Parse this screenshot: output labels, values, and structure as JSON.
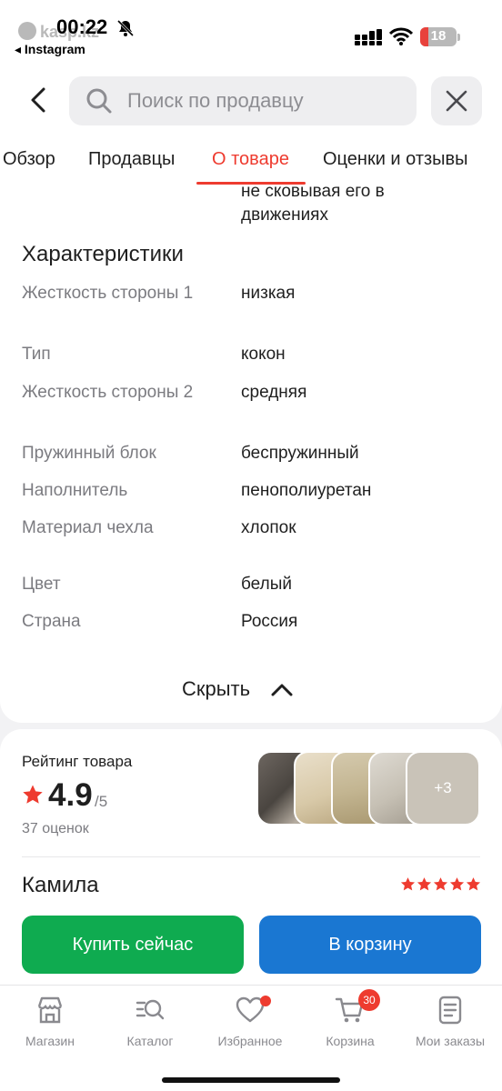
{
  "status_bar": {
    "brand_ghost": "kasp.kz",
    "time": "00:22",
    "back_app": "◂ Instagram",
    "battery": "18",
    "icons": [
      "bell-slash-icon",
      "signal-icon",
      "wifi-icon",
      "battery-icon"
    ]
  },
  "header": {
    "search_placeholder": "Поиск по продавцу",
    "icons": [
      "back-chevron-icon",
      "search-icon",
      "close-icon"
    ]
  },
  "tabs": [
    {
      "label": "Обзор",
      "active": false
    },
    {
      "label": "Продавцы",
      "active": false
    },
    {
      "label": "О товаре",
      "active": true
    },
    {
      "label": "Оценки и отзывы",
      "active": false
    }
  ],
  "details": {
    "cut_text_line1": "не сковывая его в",
    "cut_text_line2": "движениях",
    "section_title": "Характеристики",
    "rows": [
      {
        "key": "Жесткость стороны 1",
        "value": "низкая"
      },
      {
        "key": "Тип",
        "value": "кокон"
      },
      {
        "key": "Жесткость стороны 2",
        "value": "средняя"
      },
      {
        "key": "Пружинный блок",
        "value": "беспружинный"
      },
      {
        "key": "Наполнитель",
        "value": "пенополиуретан"
      },
      {
        "key": "Материал чехла",
        "value": "хлопок"
      },
      {
        "key": "Цвет",
        "value": "белый"
      },
      {
        "key": "Страна",
        "value": "Россия"
      }
    ],
    "hide_label": "Скрыть"
  },
  "rating": {
    "label": "Рейтинг товара",
    "score": "4.9",
    "out_of": "/5",
    "count": "37 оценок",
    "more_photos": "+3",
    "reviewer": "Камила",
    "reviewer_stars": 5
  },
  "actions": {
    "buy_now": "Купить сейчас",
    "add_to_cart": "В корзину"
  },
  "bottom_nav": [
    {
      "label": "Магазин",
      "icon": "store-icon"
    },
    {
      "label": "Каталог",
      "icon": "catalog-search-icon"
    },
    {
      "label": "Избранное",
      "icon": "heart-icon"
    },
    {
      "label": "Корзина",
      "icon": "cart-icon",
      "badge": "30"
    },
    {
      "label": "Мои заказы",
      "icon": "orders-icon"
    }
  ],
  "colors": {
    "accent_red": "#ee3b2f",
    "buy_green": "#0fab50",
    "cart_blue": "#1a77d2"
  }
}
